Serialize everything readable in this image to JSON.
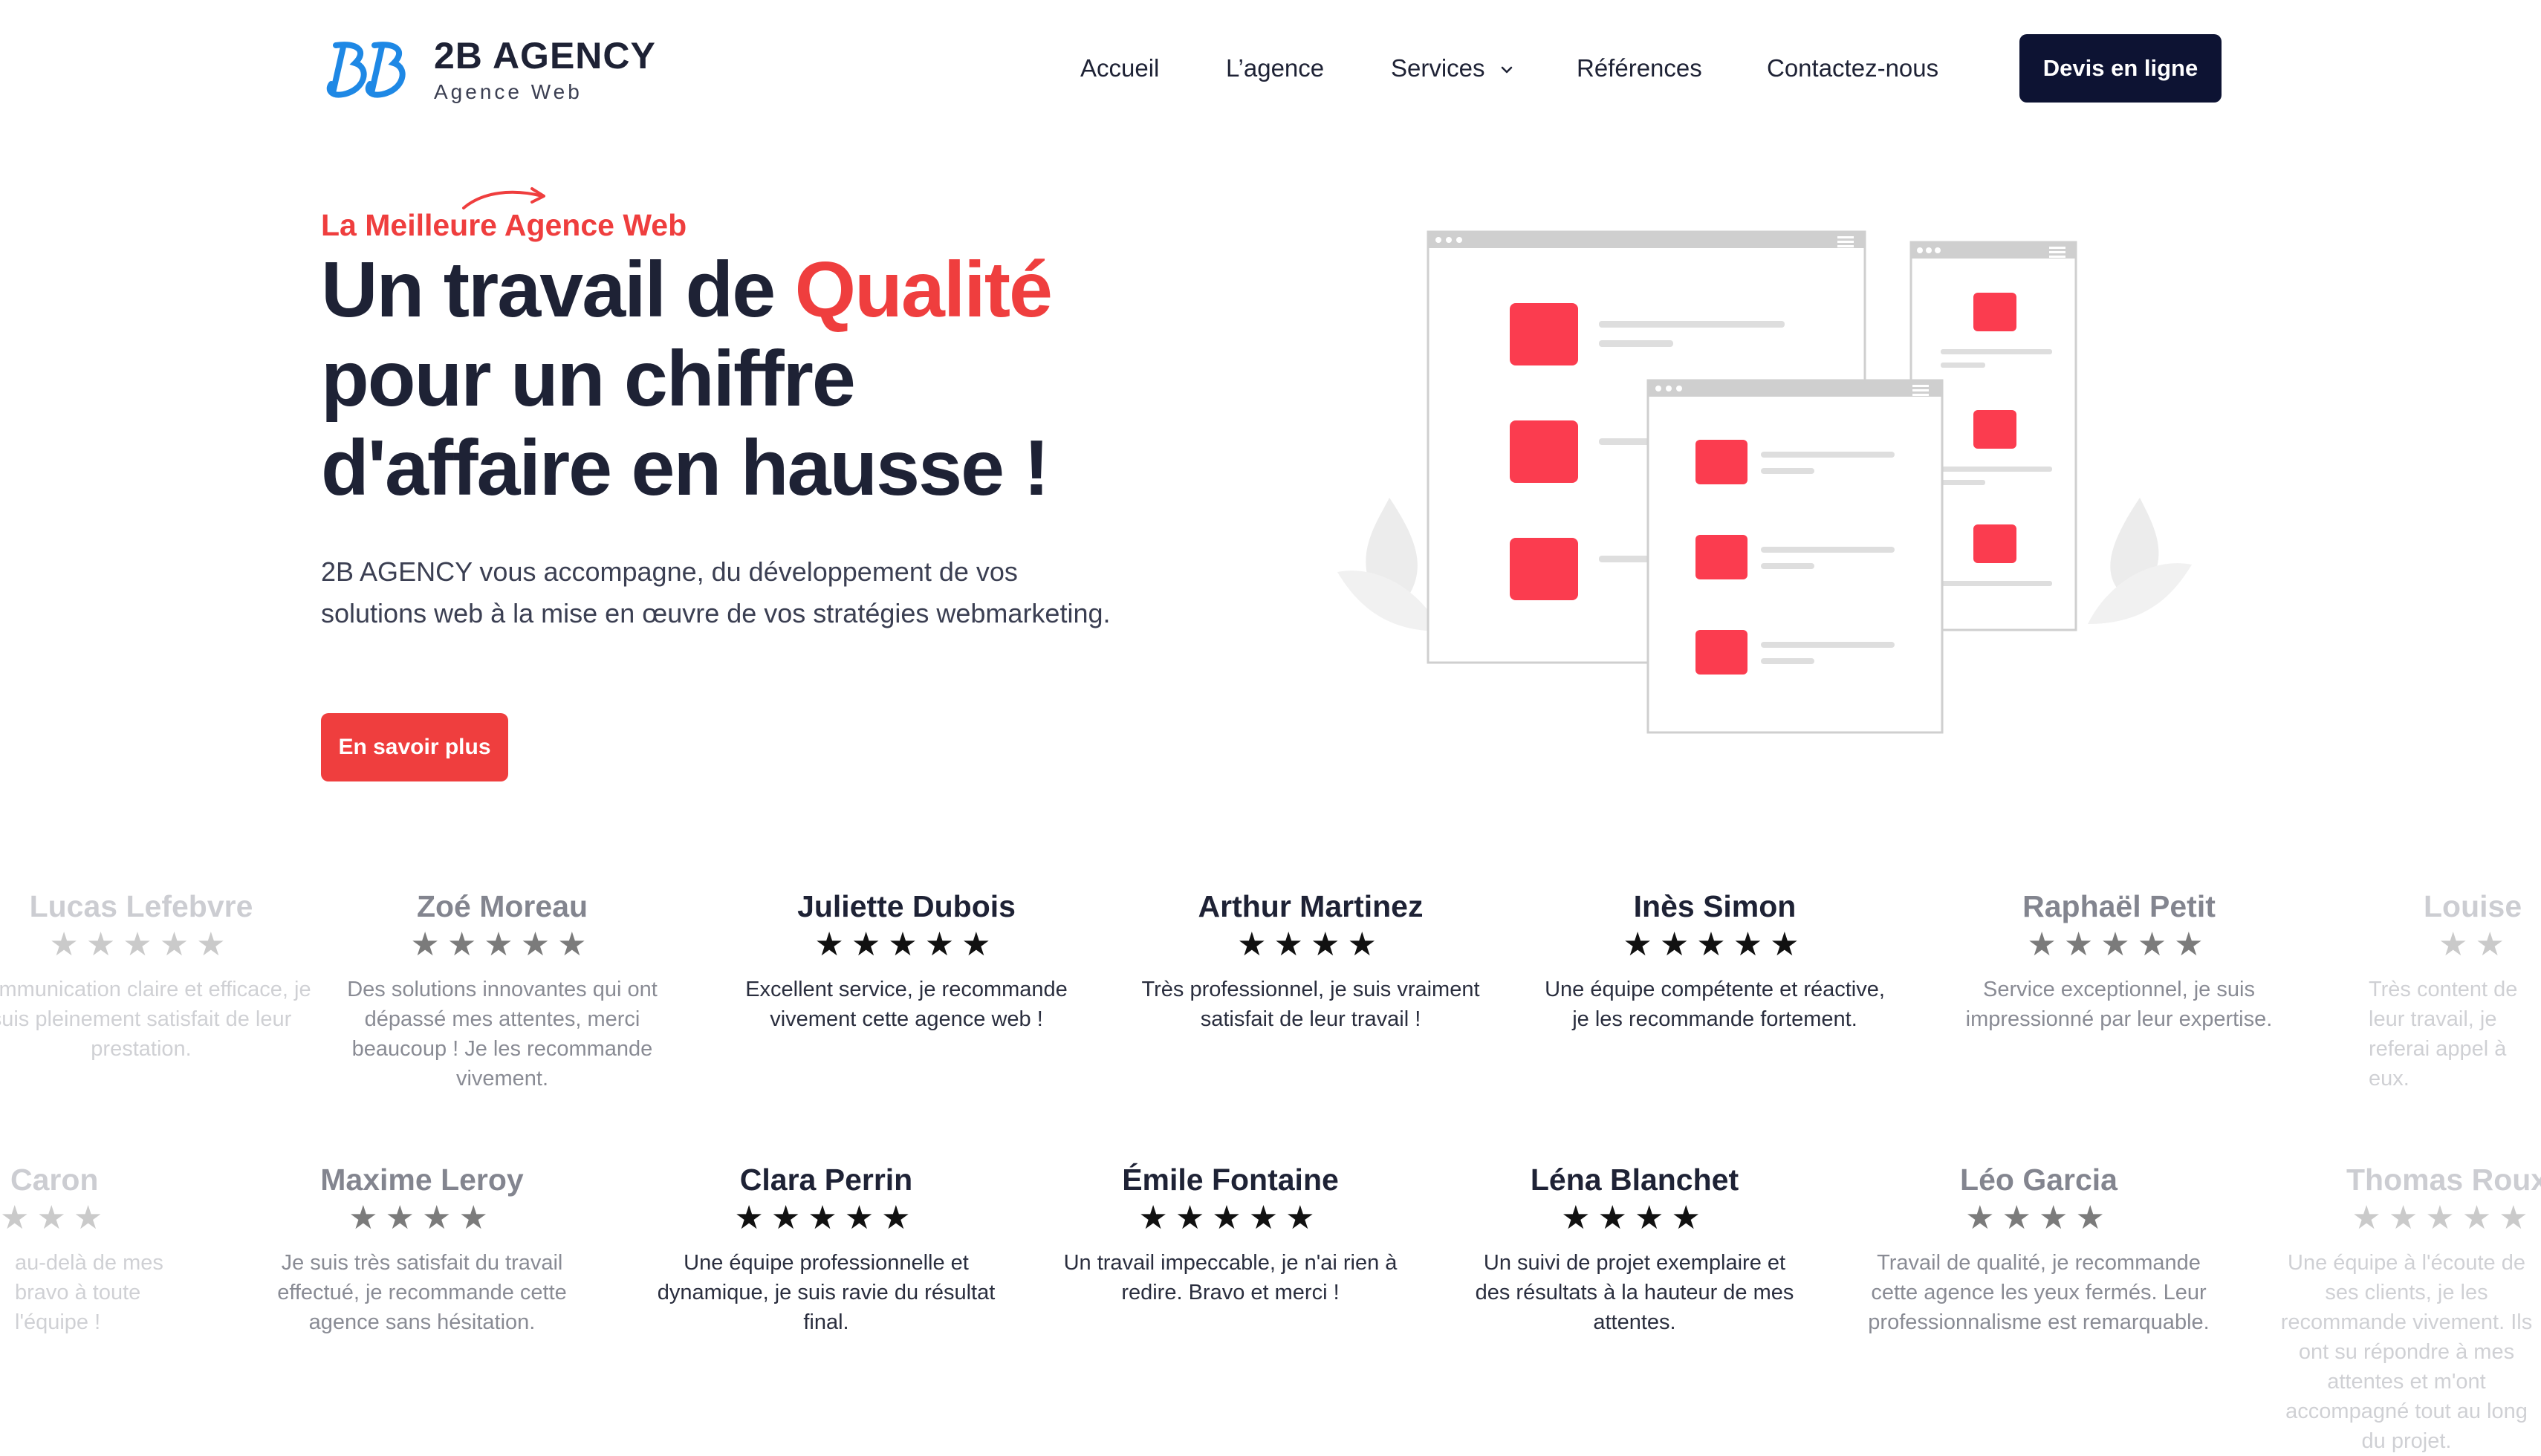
{
  "brand": {
    "name": "2B AGENCY",
    "tagline": "Agence Web",
    "color": "#1e88e5"
  },
  "nav": {
    "items": [
      "Accueil",
      "L’agence",
      "Services",
      "Références",
      "Contactez-nous"
    ],
    "cta": "Devis en ligne"
  },
  "hero": {
    "eyebrow": "La Meilleure Agence Web",
    "title_part1": "Un travail de ",
    "title_accent": "Qualité",
    "title_part2": "pour un chiffre d'affaire en hausse !",
    "description": "2B AGENCY vous accompagne, du développement de vos solutions web à la mise en œuvre de vos stratégies webmarketing.",
    "button": "En savoir plus"
  },
  "colors": {
    "accent": "#ef3e3e",
    "dark": "#1e2235",
    "navy": "#0d1333"
  },
  "testimonials_row1": [
    {
      "name": "Lucas Lefebvre",
      "stars": 5,
      "text": "Communication claire et efficace, je suis pleinement satisfait de leur prestation."
    },
    {
      "name": "Zoé Moreau",
      "stars": 5,
      "text": "Des solutions innovantes qui ont dépassé mes attentes, merci beaucoup ! Je les recommande vivement."
    },
    {
      "name": "Juliette Dubois",
      "stars": 5,
      "text": "Excellent service, je recommande vivement cette agence web !"
    },
    {
      "name": "Arthur Martinez",
      "stars": 4,
      "text": "Très professionnel, je suis vraiment satisfait de leur travail !"
    },
    {
      "name": "Inès Simon",
      "stars": 5,
      "text": "Une équipe compétente et réactive, je les recommande fortement."
    },
    {
      "name": "Raphaël Petit",
      "stars": 5,
      "text": "Service exceptionnel, je suis impressionné par leur expertise."
    },
    {
      "name": "Louise",
      "stars": 2,
      "text": "Très content de leur travail, je referai appel à eux."
    }
  ],
  "testimonials_row2": [
    {
      "name": "Caron",
      "stars": 3,
      "text": "au-delà de mes bravo à toute l'équipe !"
    },
    {
      "name": "Maxime Leroy",
      "stars": 4,
      "text": "Je suis très satisfait du travail effectué, je recommande cette agence sans hésitation."
    },
    {
      "name": "Clara Perrin",
      "stars": 5,
      "text": "Une équipe professionnelle et dynamique, je suis ravie du résultat final."
    },
    {
      "name": "Émile Fontaine",
      "stars": 5,
      "text": "Un travail impeccable, je n'ai rien à redire. Bravo et merci !"
    },
    {
      "name": "Léna Blanchet",
      "stars": 4,
      "text": "Un suivi de projet exemplaire et des résultats à la hauteur de mes attentes."
    },
    {
      "name": "Léo Garcia",
      "stars": 4,
      "text": "Travail de qualité, je recommande cette agence les yeux fermés. Leur professionnalisme est remarquable."
    },
    {
      "name": "Thomas Roux",
      "stars": 5,
      "text": "Une équipe à l'écoute de ses clients, je les recommande vivement. Ils ont su répondre à mes attentes et m'ont accompagné tout au long du projet."
    }
  ]
}
